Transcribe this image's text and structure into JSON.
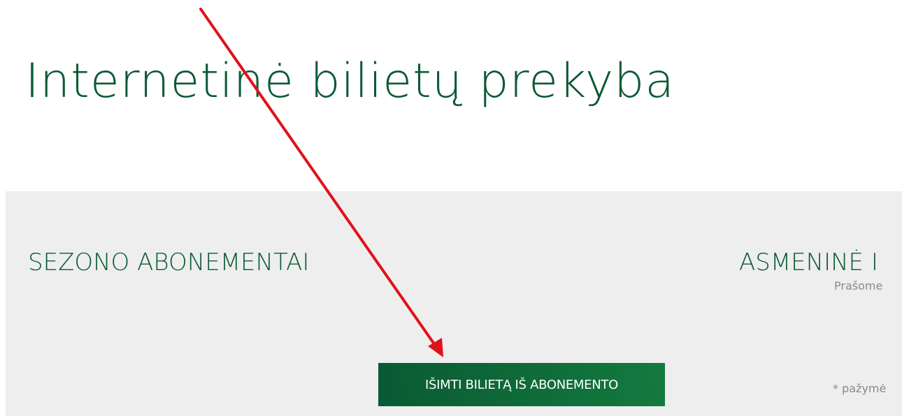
{
  "page": {
    "title": "Internetinė bilietų prekyba"
  },
  "panel": {
    "season_heading": "SEZONO ABONEMENTAI",
    "personal_heading": "ASMENINĖ I",
    "hint_please": "Prašome",
    "hint_required": "* pažymė",
    "redeem_button_label": "IŠIMTI BILIETĄ IŠ ABONEMENTO"
  },
  "annotation": {
    "arrow_color": "#e0111b"
  },
  "colors": {
    "brand_green": "#0b5a36",
    "panel_bg": "#eeeeee"
  }
}
